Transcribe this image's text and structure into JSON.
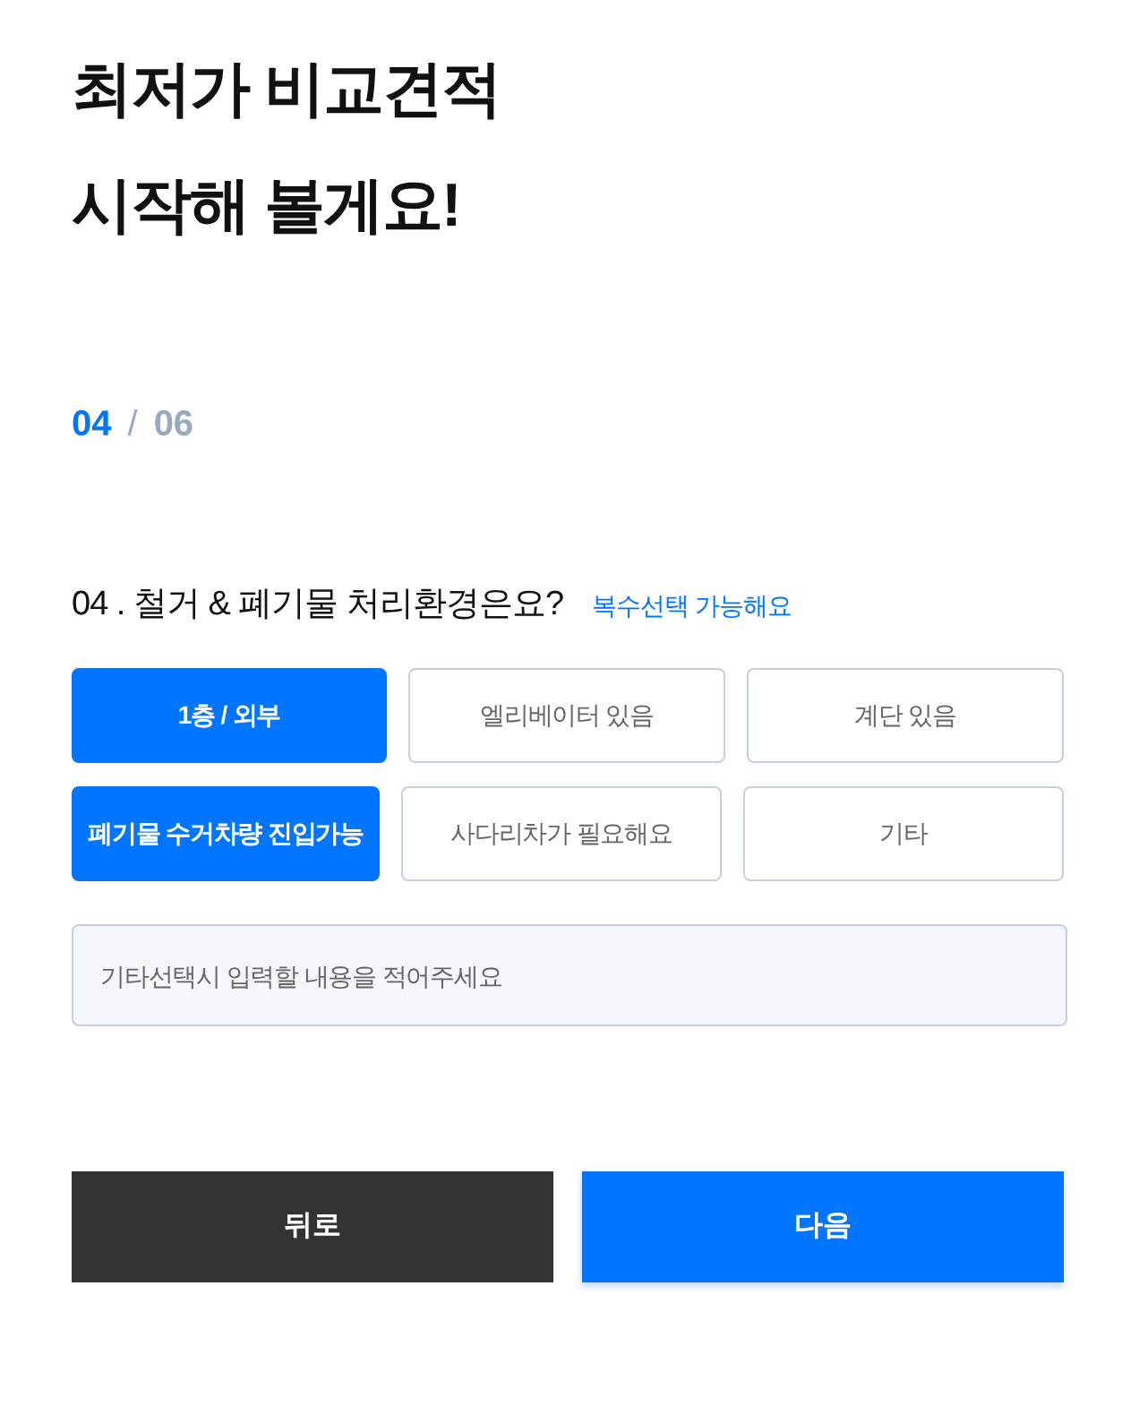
{
  "title_lines": [
    "최저가 비교견적",
    "시작해 볼게요!"
  ],
  "step": {
    "current": "04",
    "separator": "/",
    "total": "06"
  },
  "question": {
    "text": "04 . 철거 & 폐기물 처리환경은요?",
    "hint": "복수선택 가능해요"
  },
  "option_rows": [
    [
      {
        "label": "1층 / 외부",
        "selected": true
      },
      {
        "label": "엘리베이터 있음",
        "selected": false
      },
      {
        "label": "계단 있음",
        "selected": false
      }
    ],
    [
      {
        "label": "폐기물 수거차량 진입가능",
        "selected": true
      },
      {
        "label": "사다리차가 필요해요",
        "selected": false
      },
      {
        "label": "기타",
        "selected": false
      }
    ]
  ],
  "other_input": {
    "placeholder": "기타선택시 입력할 내용을 적어주세요"
  },
  "buttons": [
    {
      "kind": "back",
      "label": "뒤로"
    },
    {
      "kind": "next",
      "label": "다음"
    }
  ]
}
